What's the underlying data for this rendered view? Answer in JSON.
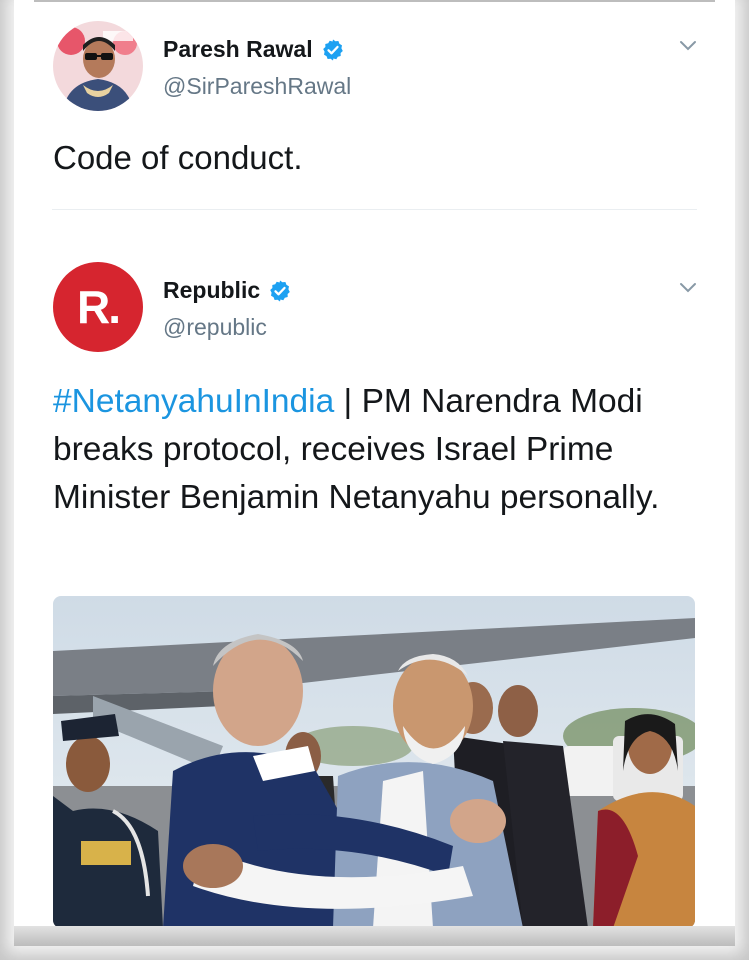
{
  "quote_tweet": {
    "display_name": "Paresh Rawal",
    "handle": "@SirPareshRawal",
    "text": "Code of conduct."
  },
  "quoted_tweet": {
    "display_name": "Republic",
    "handle": "@republic",
    "avatar_letter": "R.",
    "hashtag": "#NetanyahuInIndia",
    "text": " | PM Narendra Modi breaks protocol, receives Israel Prime Minister Benjamin Netanyahu personally."
  },
  "colors": {
    "link": "#1b95e0",
    "verified": "#1da1f2",
    "republic_red": "#d6252f",
    "handle": "#657786"
  },
  "icons": [
    "verified-badge-icon",
    "chevron-down-icon"
  ]
}
